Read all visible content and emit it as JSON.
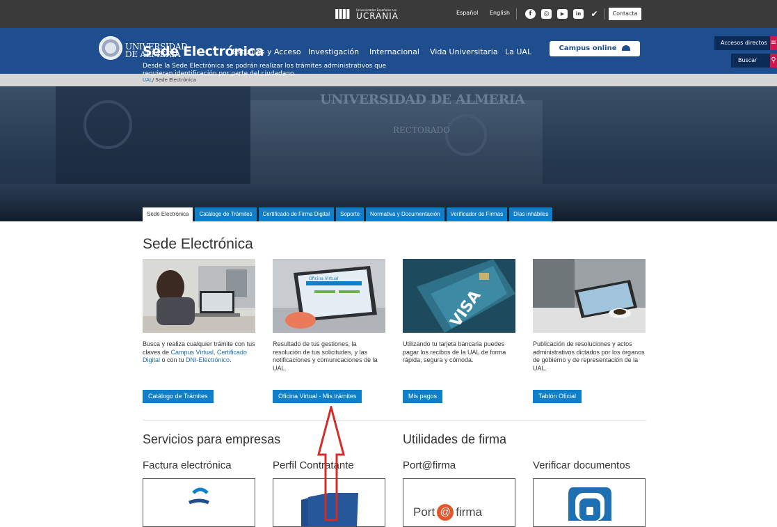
{
  "topbar": {
    "ukraine": {
      "small": "Universidades Españolas con",
      "big": "UCRANIA"
    },
    "lang_es": "Español",
    "lang_en": "English",
    "social": {
      "facebook": "f",
      "instagram": "◎",
      "youtube": "▶",
      "linkedin": "in",
      "twitter": "✔"
    },
    "contacta": "Contacta"
  },
  "header": {
    "logo_line1": "UNIVERSIDAD",
    "logo_line2": "DE ALMERÍA",
    "nav": [
      "Estudios y Acceso",
      "Investigación",
      "Internacional",
      "Vida Universitaria",
      "La UAL"
    ],
    "campus_button": "Campus online",
    "accesos": "Accesos directos",
    "buscar": "Buscar"
  },
  "breadcrumb": {
    "home": "UAL",
    "current": "/ Sede Electrónica"
  },
  "hero": {
    "bg_text1": "UNIVERSIDAD DE ALMERIA",
    "bg_text2": "RECTORADO",
    "title": "Sede Electrónica",
    "desc": "Desde la Sede Electrónica se podrán realizar los trámites administrativos que requieran identificación por parte del ciudadano."
  },
  "tabs": [
    "Sede Electrónica",
    "Catálogo de Trámites",
    "Certificado de Firma Digital",
    "Soporte",
    "Normativa y Documentación",
    "Verificador de Firmas",
    "Días inhábiles"
  ],
  "main": {
    "heading": "Sede Electrónica",
    "cards": [
      {
        "text_a": "Busca y realiza cualquier trámite con tus claves de ",
        "link1": "Campus Virtual",
        "text_b": ", ",
        "link2": "Certificado Digital",
        "text_c": " o con tu ",
        "link3": "DNI-Electrónico",
        "text_d": ".",
        "button": "Catálogo de Trámites"
      },
      {
        "text": "Resultado de tus gestiones, la resolución de tus solicitudes, y las notificaciones y comunicaciones de la UAL.",
        "button": "Oficina Virtual - Mis trámites",
        "screen_text": "Oficina Virtual"
      },
      {
        "text": "Utilizando tu tarjeta bancaria puedes pagar los recibos de la UAL de forma rápida, segura y cómoda.",
        "button": "Mis pagos",
        "card_brand": "VISA"
      },
      {
        "text": "Publicación de resoluciones y actos administrativos dictados por los órganos de gobierno y de representación de la UAL.",
        "button": "Tablón Oficial"
      }
    ],
    "section2": [
      "Servicios para empresas",
      "Utilidades de firma"
    ],
    "subsections": [
      "Factura electrónica",
      "Perfil Contratante",
      "Port@firma",
      "Verificar documentos"
    ],
    "portafirma_logo": {
      "left": "Port",
      "right": "firma"
    }
  },
  "colors": {
    "navy": "#1f4e8f",
    "blue": "#0e7fc8",
    "pink": "#d3154b",
    "arrow": "#d62b2b"
  }
}
